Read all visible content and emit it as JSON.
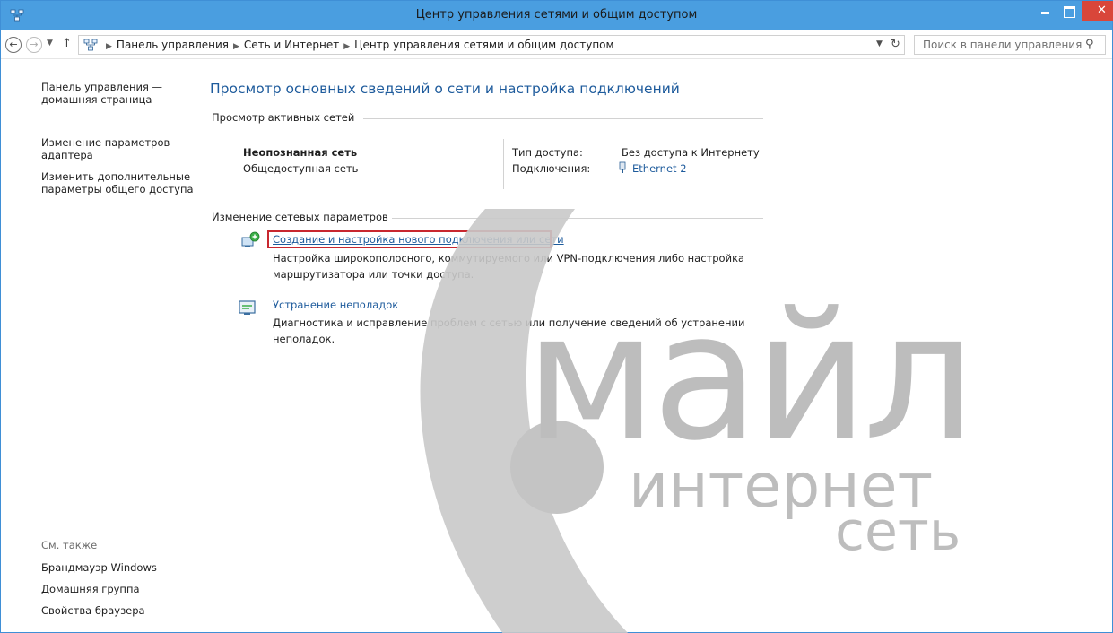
{
  "window": {
    "title": "Центр управления сетями и общим доступом",
    "close_glyph": "✕"
  },
  "address": {
    "crumbs": [
      "Панель управления",
      "Сеть и Интернет",
      "Центр управления сетями и общим доступом"
    ],
    "search_placeholder": "Поиск в панели управления"
  },
  "sidebar": {
    "home": "Панель управления — домашняя страница",
    "adapter": "Изменение параметров адаптера",
    "sharing": "Изменить дополнительные параметры общего доступа",
    "see_also": "См. также",
    "firewall": "Брандмауэр Windows",
    "homegroup": "Домашняя группа",
    "browser": "Свойства браузера"
  },
  "main": {
    "title": "Просмотр основных сведений о сети и настройка подключений",
    "active_header": "Просмотр активных сетей",
    "network_name": "Неопознанная сеть",
    "network_type": "Общедоступная сеть",
    "access_label": "Тип доступа:",
    "access_value": "Без доступа к Интернету",
    "conn_label": "Подключения:",
    "conn_value": "Ethernet 2",
    "change_header": "Изменение сетевых параметров",
    "new_conn_link": "Создание и настройка нового подключения или сети",
    "new_conn_desc": "Настройка широкополосного, коммутируемого или VPN-подключения либо настройка маршрутизатора или точки доступа.",
    "trouble_link": "Устранение неполадок",
    "trouble_desc": "Диагностика и исправление проблем с сетью или получение сведений об устранении неполадок."
  },
  "watermark": {
    "word1": "майл",
    "word2": "интернет",
    "word3": "сеть"
  },
  "colors": {
    "titlebar": "#4a9ee0",
    "close": "#d9463a",
    "link": "#1e5b9c",
    "highlight": "#c8272f",
    "watermark": "#bdbdbd"
  }
}
